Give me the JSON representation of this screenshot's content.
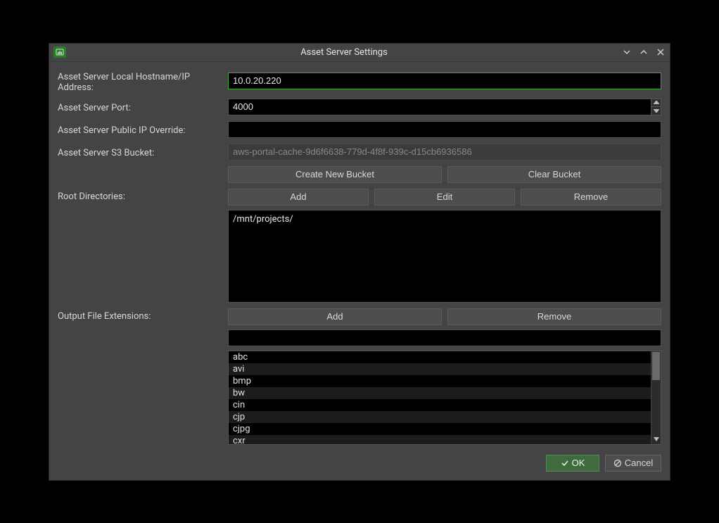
{
  "title": "Asset Server Settings",
  "labels": {
    "hostname": "Asset Server Local Hostname/IP Address:",
    "port": "Asset Server Port:",
    "public_ip": "Asset Server Public IP Override:",
    "s3_bucket": "Asset Server S3 Bucket:",
    "root_dirs": "Root Directories:",
    "output_ext": "Output File Extensions:"
  },
  "fields": {
    "hostname": "10.0.20.220",
    "port": "4000",
    "public_ip": "",
    "s3_bucket": "aws-portal-cache-9d6f6638-779d-4f8f-939c-d15cb6936586",
    "ext_input": ""
  },
  "buttons": {
    "create_bucket": "Create New Bucket",
    "clear_bucket": "Clear Bucket",
    "add": "Add",
    "edit": "Edit",
    "remove": "Remove",
    "ext_add": "Add",
    "ext_remove": "Remove",
    "ok": "OK",
    "cancel": "Cancel"
  },
  "root_directories": [
    "/mnt/projects/"
  ],
  "extensions": [
    "abc",
    "avi",
    "bmp",
    "bw",
    "cin",
    "cjp",
    "cjpg",
    "cxr"
  ]
}
